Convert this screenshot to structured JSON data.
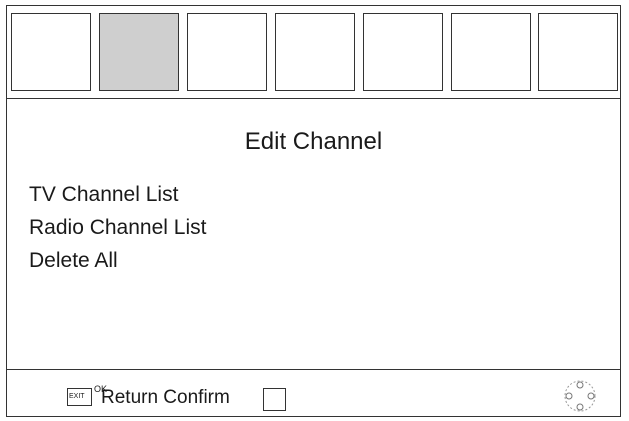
{
  "tabs": [
    {
      "label": "",
      "selected": false
    },
    {
      "label": "",
      "selected": true
    },
    {
      "label": "",
      "selected": false
    },
    {
      "label": "",
      "selected": false
    },
    {
      "label": "",
      "selected": false
    },
    {
      "label": "",
      "selected": false
    },
    {
      "label": "",
      "selected": false
    }
  ],
  "title": "Edit Channel",
  "menu": {
    "items": [
      "TV Channel List",
      "Radio Channel List",
      "Delete All"
    ]
  },
  "footer": {
    "exit_key_label": "EXIT",
    "ok_overlap_label": "OK",
    "label": "Return Confirm",
    "nav_icon": "dpad-navigation-icon"
  },
  "colors": {
    "selected_tab": "#cfcfcf",
    "border": "#333333"
  }
}
